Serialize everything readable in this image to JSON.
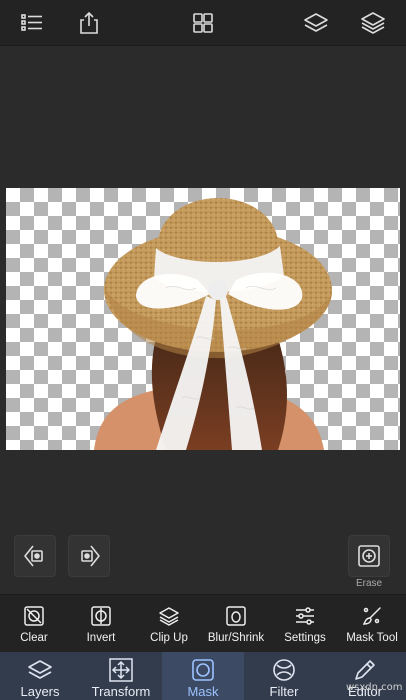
{
  "topbar": {
    "icons": [
      "list-icon",
      "share-icon",
      "grid-icon",
      "layers-icon",
      "layers-stack-icon"
    ]
  },
  "canvas": {
    "image_alt": "Woman wearing a straw hat with white lace ribbon, background removed"
  },
  "controls": {
    "erase_label": "Erase"
  },
  "tools": [
    {
      "label": "Clear",
      "icon": "clear-icon"
    },
    {
      "label": "Invert",
      "icon": "invert-icon"
    },
    {
      "label": "Clip Up",
      "icon": "clip-up-icon"
    },
    {
      "label": "Blur/Shrink",
      "icon": "blur-shrink-icon"
    },
    {
      "label": "Settings",
      "icon": "settings-icon"
    },
    {
      "label": "Mask Tool",
      "icon": "mask-tool-icon"
    }
  ],
  "tabs": [
    {
      "label": "Layers",
      "icon": "layers-icon"
    },
    {
      "label": "Transform",
      "icon": "transform-icon"
    },
    {
      "label": "Mask",
      "icon": "mask-icon",
      "active": true
    },
    {
      "label": "Filter",
      "icon": "filter-icon"
    },
    {
      "label": "Editor",
      "icon": "pencil-icon"
    }
  ],
  "watermark": "wsxdn.com",
  "colors": {
    "tab_bar": "#333c4c",
    "active_tab_text": "#9cc3ff",
    "toolbar": "#232323"
  }
}
